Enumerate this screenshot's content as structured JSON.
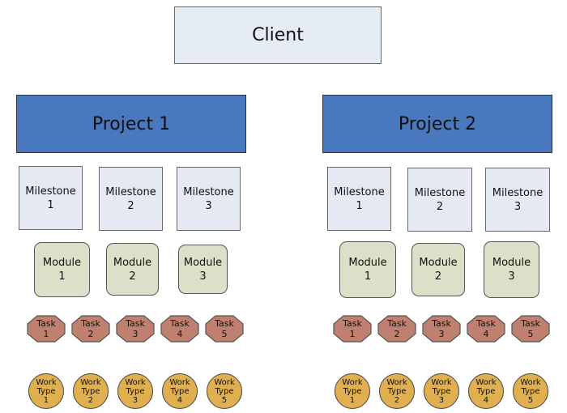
{
  "client": {
    "label": "Client"
  },
  "projects": [
    {
      "label": "Project 1",
      "milestones": [
        "Milestone\n1",
        "Milestone\n2",
        "Milestone\n3"
      ],
      "modules": [
        "Module\n1",
        "Module\n2",
        "Module\n3"
      ],
      "tasks": [
        "Task\n1",
        "Task\n2",
        "Task\n3",
        "Task\n4",
        "Task\n5"
      ],
      "work_types": [
        "Work\nType\n1",
        "Work\nType\n2",
        "Work\nType\n3",
        "Work\nType\n4",
        "Work\nType\n5"
      ]
    },
    {
      "label": "Project 2",
      "milestones": [
        "Milestone\n1",
        "Milestone\n2",
        "Milestone\n3"
      ],
      "modules": [
        "Module\n1",
        "Module\n2",
        "Module\n3"
      ],
      "tasks": [
        "Task\n1",
        "Task\n2",
        "Task\n3",
        "Task\n4",
        "Task\n5"
      ],
      "work_types": [
        "Work\nType\n1",
        "Work\nType\n2",
        "Work\nType\n3",
        "Work\nType\n4",
        "Work\nType\n5"
      ]
    }
  ],
  "colors": {
    "client": "#e6ecf6",
    "project": "#4a78be",
    "milestone": "#e4e9f4",
    "module": "#dce0c8",
    "task": "#c08070",
    "work_type": "#e0b050"
  }
}
